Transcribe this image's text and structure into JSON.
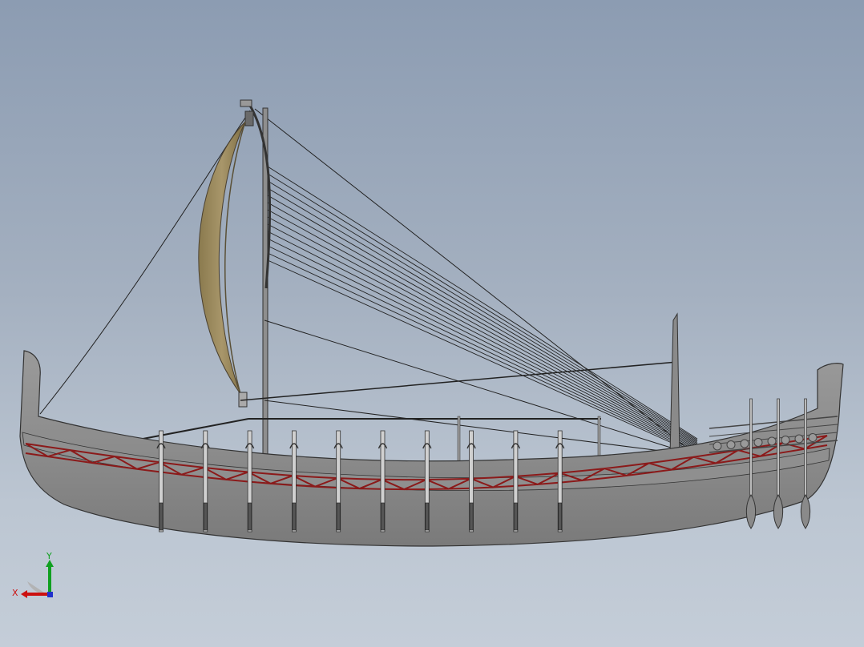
{
  "viewport": {
    "background_top": "#8c9cb2",
    "background_bottom": "#c4cdd8"
  },
  "model": {
    "hull_color": "#8f8f8f",
    "hull_band_color": "#8b1a1a",
    "sail_color": "#9a8a5c",
    "oar_count_side": 10,
    "steering_oar_count": 3
  },
  "triad": {
    "x_label": "X",
    "y_label": "Y",
    "x_color": "#cc1010",
    "y_color": "#10a020",
    "z_color": "#2030cc"
  }
}
